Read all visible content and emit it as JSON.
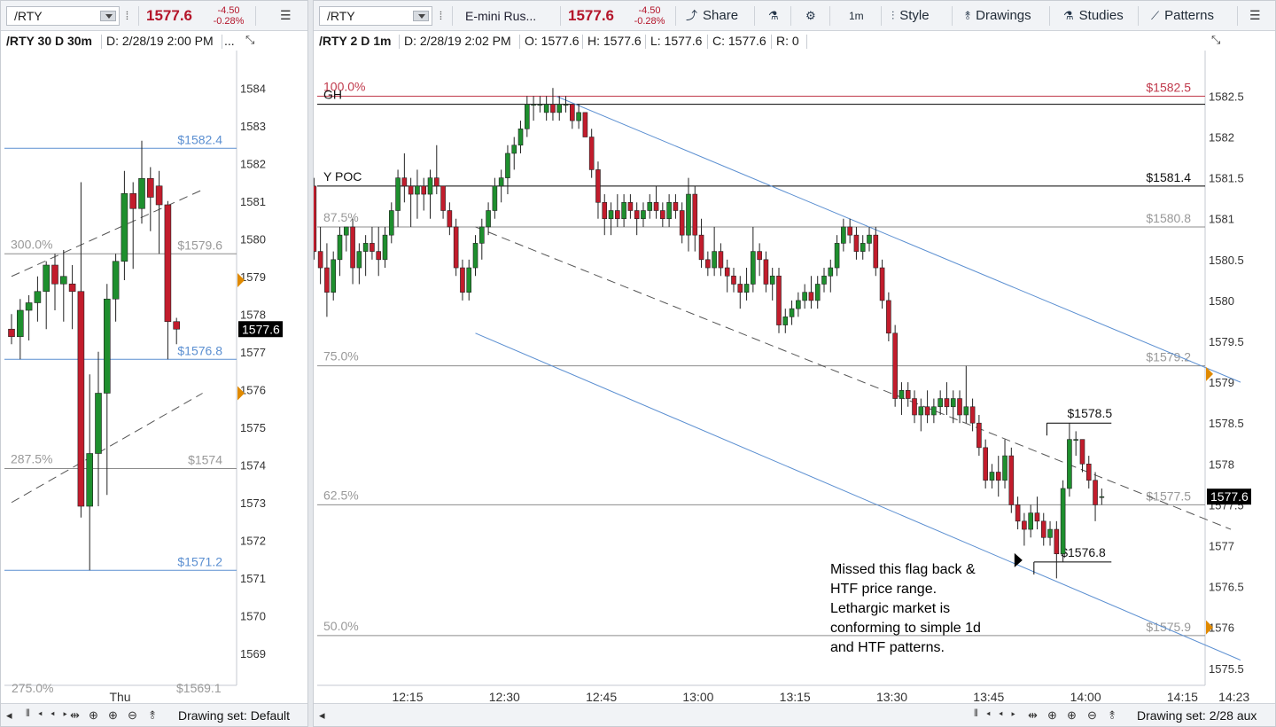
{
  "left": {
    "toolbar": {
      "symbol": "/RTY",
      "price": "1577.6",
      "change": "-4.50",
      "change_pct": "-0.28%"
    },
    "info": {
      "title": "/RTY 30 D 30m",
      "date": "D: 2/28/19 2:00 PM",
      "more": "..."
    },
    "bottom": {
      "drawing_set": "Drawing set: Default"
    }
  },
  "right": {
    "toolbar": {
      "symbol": "/RTY",
      "description": "E-mini Rus...",
      "price": "1577.6",
      "change": "-4.50",
      "change_pct": "-0.28%",
      "share": "Share",
      "interval": "1m",
      "style": "Style",
      "drawings": "Drawings",
      "studies": "Studies",
      "patterns": "Patterns"
    },
    "info": {
      "title": "/RTY 2 D 1m",
      "date": "D: 2/28/19 2:02 PM",
      "open": "O: 1577.6",
      "high": "H: 1577.6",
      "low": "L: 1577.6",
      "close": "C: 1577.6",
      "range": "R: 0"
    },
    "bottom": {
      "drawing_set": "Drawing set: 2/28 aux"
    }
  },
  "colors": {
    "up": "#1e8f2e",
    "down": "#c21c2c",
    "fib_level": "#8c8c8c",
    "channel": "#5b8fd1",
    "hline": "#000000",
    "red_line": "#c0394b",
    "last_price_bg": "#000000",
    "marker": "#e08a00",
    "accent_price": "#b4162b"
  },
  "chart_data": [
    {
      "type": "candlestick",
      "name": "/RTY 30 D 30m",
      "ylim": [
        1568.5,
        1584.5
      ],
      "y_ticks": [
        1584,
        1583,
        1582,
        1581,
        1580,
        1579,
        1578,
        1577,
        1576,
        1575,
        1574,
        1573,
        1572,
        1571,
        1570,
        1569
      ],
      "x_ticks": [
        {
          "label": "Thu",
          "index": 12.5
        }
      ],
      "last_price": "1577.6",
      "last_price_value": 1577.6,
      "ohlc": [
        [
          1577.6,
          1578.0,
          1577.2,
          1577.4
        ],
        [
          1577.4,
          1578.4,
          1576.8,
          1578.1
        ],
        [
          1578.1,
          1578.5,
          1577.3,
          1578.3
        ],
        [
          1578.3,
          1579.0,
          1577.8,
          1578.6
        ],
        [
          1578.6,
          1579.4,
          1577.6,
          1579.3
        ],
        [
          1579.3,
          1579.6,
          1578.1,
          1578.8
        ],
        [
          1578.8,
          1579.7,
          1577.8,
          1579.0
        ],
        [
          1578.8,
          1579.3,
          1577.6,
          1578.6
        ],
        [
          1578.6,
          1581.5,
          1572.6,
          1572.9
        ],
        [
          1572.9,
          1576.4,
          1571.2,
          1574.3
        ],
        [
          1574.3,
          1577.0,
          1572.9,
          1575.9
        ],
        [
          1575.9,
          1578.8,
          1573.2,
          1578.4
        ],
        [
          1578.4,
          1579.6,
          1577.8,
          1579.4
        ],
        [
          1579.4,
          1581.8,
          1578.9,
          1581.2
        ],
        [
          1581.2,
          1581.5,
          1579.2,
          1580.8
        ],
        [
          1580.8,
          1582.6,
          1580.4,
          1581.6
        ],
        [
          1581.6,
          1581.9,
          1580.2,
          1581.1
        ],
        [
          1581.4,
          1581.8,
          1579.6,
          1580.9
        ],
        [
          1580.9,
          1581.0,
          1576.8,
          1577.8
        ],
        [
          1577.8,
          1577.9,
          1577.2,
          1577.6
        ]
      ],
      "hlines": [
        {
          "value": 1582.4,
          "label": "$1582.4",
          "color": "blue"
        },
        {
          "value": 1579.6,
          "label": "$1579.6",
          "left_label": "300.0%",
          "color": "gray"
        },
        {
          "value": 1576.8,
          "label": "$1576.8",
          "color": "blue"
        },
        {
          "value": 1573.9,
          "label": "$1574",
          "left_label": "287.5%",
          "color": "gray"
        },
        {
          "value": 1571.2,
          "label": "$1571.2",
          "color": "blue"
        }
      ],
      "bottom_partial_labels": [
        "275.0%",
        "$1569.1"
      ],
      "trend_lines": [
        {
          "from": [
            0,
            1579.0
          ],
          "to": [
            22,
            1581.3
          ],
          "dashed": true
        },
        {
          "from": [
            0,
            1573.0
          ],
          "to": [
            22,
            1575.9
          ],
          "dashed": true
        }
      ],
      "markers": [
        1578.9,
        1575.9
      ]
    },
    {
      "type": "candlestick",
      "name": "/RTY 2 D 1m",
      "ylim": [
        1575.4,
        1582.7
      ],
      "y_ticks": [
        1582.5,
        1582,
        1581.5,
        1581,
        1580.5,
        1580,
        1579.5,
        1579,
        1578.5,
        1578,
        1577.5,
        1577,
        1576.5,
        1576,
        1575.5
      ],
      "x_ticks": [
        "12:15",
        "12:30",
        "12:45",
        "13:00",
        "13:15",
        "13:30",
        "13:45",
        "14:00",
        "14:15",
        "14:23"
      ],
      "x_tick_times": [
        12.25,
        12.5,
        12.75,
        13.0,
        13.25,
        13.5,
        13.75,
        14.0,
        14.25,
        14.3833
      ],
      "x_range_times": [
        12.0167,
        14.4
      ],
      "bar_start_time": 12.0,
      "bar_minutes": 1,
      "last_price": "1577.6",
      "last_price_value": 1577.6,
      "ohlc": [
        [
          1581.4,
          1581.5,
          1580.5,
          1580.6
        ],
        [
          1580.6,
          1580.9,
          1580.2,
          1580.4
        ],
        [
          1580.4,
          1580.7,
          1579.8,
          1580.1
        ],
        [
          1580.1,
          1580.6,
          1580.0,
          1580.5
        ],
        [
          1580.5,
          1580.9,
          1580.3,
          1580.8
        ],
        [
          1580.8,
          1580.9,
          1580.6,
          1580.9
        ],
        [
          1580.9,
          1581.0,
          1580.2,
          1580.4
        ],
        [
          1580.4,
          1580.7,
          1580.2,
          1580.6
        ],
        [
          1580.6,
          1580.8,
          1580.3,
          1580.7
        ],
        [
          1580.7,
          1580.9,
          1580.5,
          1580.6
        ],
        [
          1580.6,
          1580.9,
          1580.3,
          1580.5
        ],
        [
          1580.5,
          1580.9,
          1580.4,
          1580.8
        ],
        [
          1580.8,
          1581.2,
          1580.7,
          1581.1
        ],
        [
          1581.1,
          1581.6,
          1580.9,
          1581.5
        ],
        [
          1581.5,
          1581.8,
          1581.2,
          1581.4
        ],
        [
          1581.4,
          1581.5,
          1580.9,
          1581.3
        ],
        [
          1581.3,
          1581.6,
          1581.0,
          1581.4
        ],
        [
          1581.4,
          1581.5,
          1581.1,
          1581.3
        ],
        [
          1581.3,
          1581.6,
          1581.0,
          1581.5
        ],
        [
          1581.5,
          1581.9,
          1581.3,
          1581.4
        ],
        [
          1581.4,
          1581.4,
          1581.0,
          1581.1
        ],
        [
          1581.1,
          1581.2,
          1580.8,
          1580.9
        ],
        [
          1580.9,
          1581.0,
          1580.3,
          1580.4
        ],
        [
          1580.4,
          1580.5,
          1580.0,
          1580.1
        ],
        [
          1580.1,
          1580.5,
          1580.0,
          1580.4
        ],
        [
          1580.4,
          1580.8,
          1580.3,
          1580.7
        ],
        [
          1580.7,
          1581.0,
          1580.5,
          1580.9
        ],
        [
          1580.9,
          1581.2,
          1580.8,
          1581.1
        ],
        [
          1581.1,
          1581.5,
          1581.0,
          1581.4
        ],
        [
          1581.4,
          1581.6,
          1581.2,
          1581.5
        ],
        [
          1581.5,
          1581.9,
          1581.3,
          1581.8
        ],
        [
          1581.8,
          1582.0,
          1581.6,
          1581.9
        ],
        [
          1581.9,
          1582.2,
          1581.8,
          1582.1
        ],
        [
          1582.1,
          1582.5,
          1582.0,
          1582.4
        ],
        [
          1582.4,
          1582.5,
          1582.2,
          1582.4
        ],
        [
          1582.4,
          1582.5,
          1582.3,
          1582.4
        ],
        [
          1582.3,
          1582.5,
          1582.2,
          1582.4
        ],
        [
          1582.4,
          1582.6,
          1582.2,
          1582.3
        ],
        [
          1582.3,
          1582.5,
          1582.2,
          1582.4
        ],
        [
          1582.4,
          1582.5,
          1582.3,
          1582.4
        ],
        [
          1582.4,
          1582.4,
          1582.1,
          1582.2
        ],
        [
          1582.2,
          1582.4,
          1582.1,
          1582.3
        ],
        [
          1582.3,
          1582.3,
          1582.0,
          1582.0
        ],
        [
          1582.0,
          1582.1,
          1581.5,
          1581.6
        ],
        [
          1581.6,
          1581.7,
          1581.0,
          1581.2
        ],
        [
          1581.2,
          1581.3,
          1580.8,
          1581.0
        ],
        [
          1581.0,
          1581.2,
          1580.8,
          1581.1
        ],
        [
          1581.1,
          1581.3,
          1580.9,
          1581.0
        ],
        [
          1581.0,
          1581.3,
          1580.9,
          1581.2
        ],
        [
          1581.2,
          1581.3,
          1581.0,
          1581.1
        ],
        [
          1581.1,
          1581.2,
          1580.8,
          1581.0
        ],
        [
          1581.0,
          1581.2,
          1580.9,
          1581.1
        ],
        [
          1581.1,
          1581.3,
          1581.0,
          1581.2
        ],
        [
          1581.2,
          1581.4,
          1581.0,
          1581.1
        ],
        [
          1581.1,
          1581.2,
          1580.9,
          1581.0
        ],
        [
          1581.0,
          1581.3,
          1580.9,
          1581.2
        ],
        [
          1581.2,
          1581.3,
          1581.0,
          1581.1
        ],
        [
          1581.1,
          1581.2,
          1580.7,
          1580.8
        ],
        [
          1580.8,
          1581.5,
          1580.6,
          1581.3
        ],
        [
          1581.3,
          1581.4,
          1580.6,
          1580.8
        ],
        [
          1580.8,
          1581.0,
          1580.4,
          1580.5
        ],
        [
          1580.5,
          1580.6,
          1580.3,
          1580.4
        ],
        [
          1580.4,
          1580.9,
          1580.3,
          1580.6
        ],
        [
          1580.6,
          1580.7,
          1580.3,
          1580.4
        ],
        [
          1580.4,
          1580.5,
          1580.1,
          1580.3
        ],
        [
          1580.3,
          1580.4,
          1580.1,
          1580.2
        ],
        [
          1580.2,
          1580.3,
          1579.9,
          1580.1
        ],
        [
          1580.1,
          1580.4,
          1580.0,
          1580.2
        ],
        [
          1580.2,
          1580.9,
          1580.1,
          1580.6
        ],
        [
          1580.6,
          1580.7,
          1580.3,
          1580.5
        ],
        [
          1580.5,
          1580.6,
          1580.1,
          1580.2
        ],
        [
          1580.2,
          1580.4,
          1580.0,
          1580.3
        ],
        [
          1580.3,
          1580.4,
          1579.6,
          1579.7
        ],
        [
          1579.7,
          1579.9,
          1579.6,
          1579.8
        ],
        [
          1579.8,
          1580.0,
          1579.7,
          1579.9
        ],
        [
          1579.9,
          1580.1,
          1579.8,
          1580.0
        ],
        [
          1580.0,
          1580.2,
          1579.9,
          1580.1
        ],
        [
          1580.1,
          1580.3,
          1579.9,
          1580.0
        ],
        [
          1580.0,
          1580.3,
          1579.9,
          1580.2
        ],
        [
          1580.2,
          1580.4,
          1580.1,
          1580.3
        ],
        [
          1580.3,
          1580.5,
          1580.1,
          1580.4
        ],
        [
          1580.4,
          1580.8,
          1580.3,
          1580.7
        ],
        [
          1580.7,
          1581.0,
          1580.6,
          1580.9
        ],
        [
          1580.9,
          1581.0,
          1580.7,
          1580.8
        ],
        [
          1580.8,
          1580.9,
          1580.5,
          1580.6
        ],
        [
          1580.6,
          1580.8,
          1580.5,
          1580.7
        ],
        [
          1580.7,
          1580.9,
          1580.6,
          1580.8
        ],
        [
          1580.8,
          1580.9,
          1580.3,
          1580.4
        ],
        [
          1580.4,
          1580.5,
          1579.9,
          1580.0
        ],
        [
          1580.0,
          1580.1,
          1579.5,
          1579.6
        ],
        [
          1579.6,
          1579.7,
          1578.7,
          1578.8
        ],
        [
          1578.8,
          1579.0,
          1578.6,
          1578.9
        ],
        [
          1578.9,
          1579.0,
          1578.7,
          1578.8
        ],
        [
          1578.8,
          1578.9,
          1578.5,
          1578.6
        ],
        [
          1578.6,
          1578.8,
          1578.4,
          1578.7
        ],
        [
          1578.7,
          1578.9,
          1578.5,
          1578.6
        ],
        [
          1578.6,
          1578.8,
          1578.5,
          1578.7
        ],
        [
          1578.7,
          1578.9,
          1578.6,
          1578.8
        ],
        [
          1578.8,
          1579.0,
          1578.6,
          1578.7
        ],
        [
          1578.7,
          1578.9,
          1578.5,
          1578.8
        ],
        [
          1578.8,
          1578.9,
          1578.5,
          1578.6
        ],
        [
          1578.6,
          1579.2,
          1578.5,
          1578.7
        ],
        [
          1578.7,
          1578.8,
          1578.4,
          1578.5
        ],
        [
          1578.5,
          1578.6,
          1578.1,
          1578.2
        ],
        [
          1578.2,
          1578.3,
          1577.7,
          1577.8
        ],
        [
          1577.8,
          1578.0,
          1577.7,
          1577.9
        ],
        [
          1577.9,
          1578.1,
          1577.6,
          1577.8
        ],
        [
          1577.8,
          1578.3,
          1577.7,
          1578.1
        ],
        [
          1578.1,
          1578.2,
          1577.4,
          1577.5
        ],
        [
          1577.5,
          1577.6,
          1577.2,
          1577.3
        ],
        [
          1577.3,
          1577.4,
          1577.0,
          1577.2
        ],
        [
          1577.2,
          1577.5,
          1577.1,
          1577.4
        ],
        [
          1577.4,
          1577.6,
          1577.2,
          1577.3
        ],
        [
          1577.3,
          1577.4,
          1577.0,
          1577.1
        ],
        [
          1577.1,
          1577.3,
          1577.0,
          1577.2
        ],
        [
          1577.2,
          1577.3,
          1576.6,
          1576.9
        ],
        [
          1576.9,
          1577.8,
          1576.8,
          1577.7
        ],
        [
          1577.7,
          1578.5,
          1577.6,
          1578.3
        ],
        [
          1578.3,
          1578.4,
          1578.1,
          1578.3
        ],
        [
          1578.3,
          1578.3,
          1577.9,
          1578.0
        ],
        [
          1578.0,
          1578.1,
          1577.7,
          1577.8
        ],
        [
          1577.8,
          1577.9,
          1577.3,
          1577.5
        ],
        [
          1577.6,
          1577.7,
          1577.5,
          1577.6
        ]
      ],
      "hlines": [
        {
          "value": 1582.5,
          "label": "$1582.5",
          "left_label": "100.0%",
          "color": "red"
        },
        {
          "value": 1582.4,
          "left_label": "GH",
          "color": "black"
        },
        {
          "value": 1581.4,
          "label": "$1581.4",
          "left_label": "Y POC",
          "color": "black"
        },
        {
          "value": 1580.9,
          "label": "$1580.8",
          "left_label": "87.5%",
          "color": "gray"
        },
        {
          "value": 1579.2,
          "label": "$1579.2",
          "left_label": "75.0%",
          "color": "gray"
        },
        {
          "value": 1577.5,
          "label": "$1577.5",
          "left_label": "62.5%",
          "color": "gray"
        },
        {
          "value": 1575.9,
          "label": "$1575.9",
          "left_label": "50.0%",
          "color": "gray"
        }
      ],
      "short_lines": [
        {
          "value": 1578.5,
          "label": "$1578.5",
          "from": 113.5,
          "to": 123.5
        },
        {
          "value": 1576.8,
          "label": "$1576.8",
          "from": 111.5,
          "to": 123.5
        }
      ],
      "trend_lines": [
        {
          "from": [
            37.5,
            1582.5
          ],
          "to": [
            143.5,
            1579.0
          ],
          "dashed": false
        },
        {
          "from": [
            25,
            1579.6
          ],
          "to": [
            143.5,
            1575.6
          ],
          "dashed": false
        },
        {
          "from": [
            25,
            1580.9
          ],
          "to": [
            142,
            1577.2
          ],
          "dashed": true
        }
      ],
      "annotation": [
        "Missed this flag back &",
        "HTF price range.",
        "Lethargic market is",
        "conforming to simple 1d",
        "and HTF patterns."
      ],
      "annotation_anchor": {
        "x": 111.5,
        "y": 1576.8
      },
      "markers": [
        1579.1,
        1576.0
      ]
    }
  ]
}
